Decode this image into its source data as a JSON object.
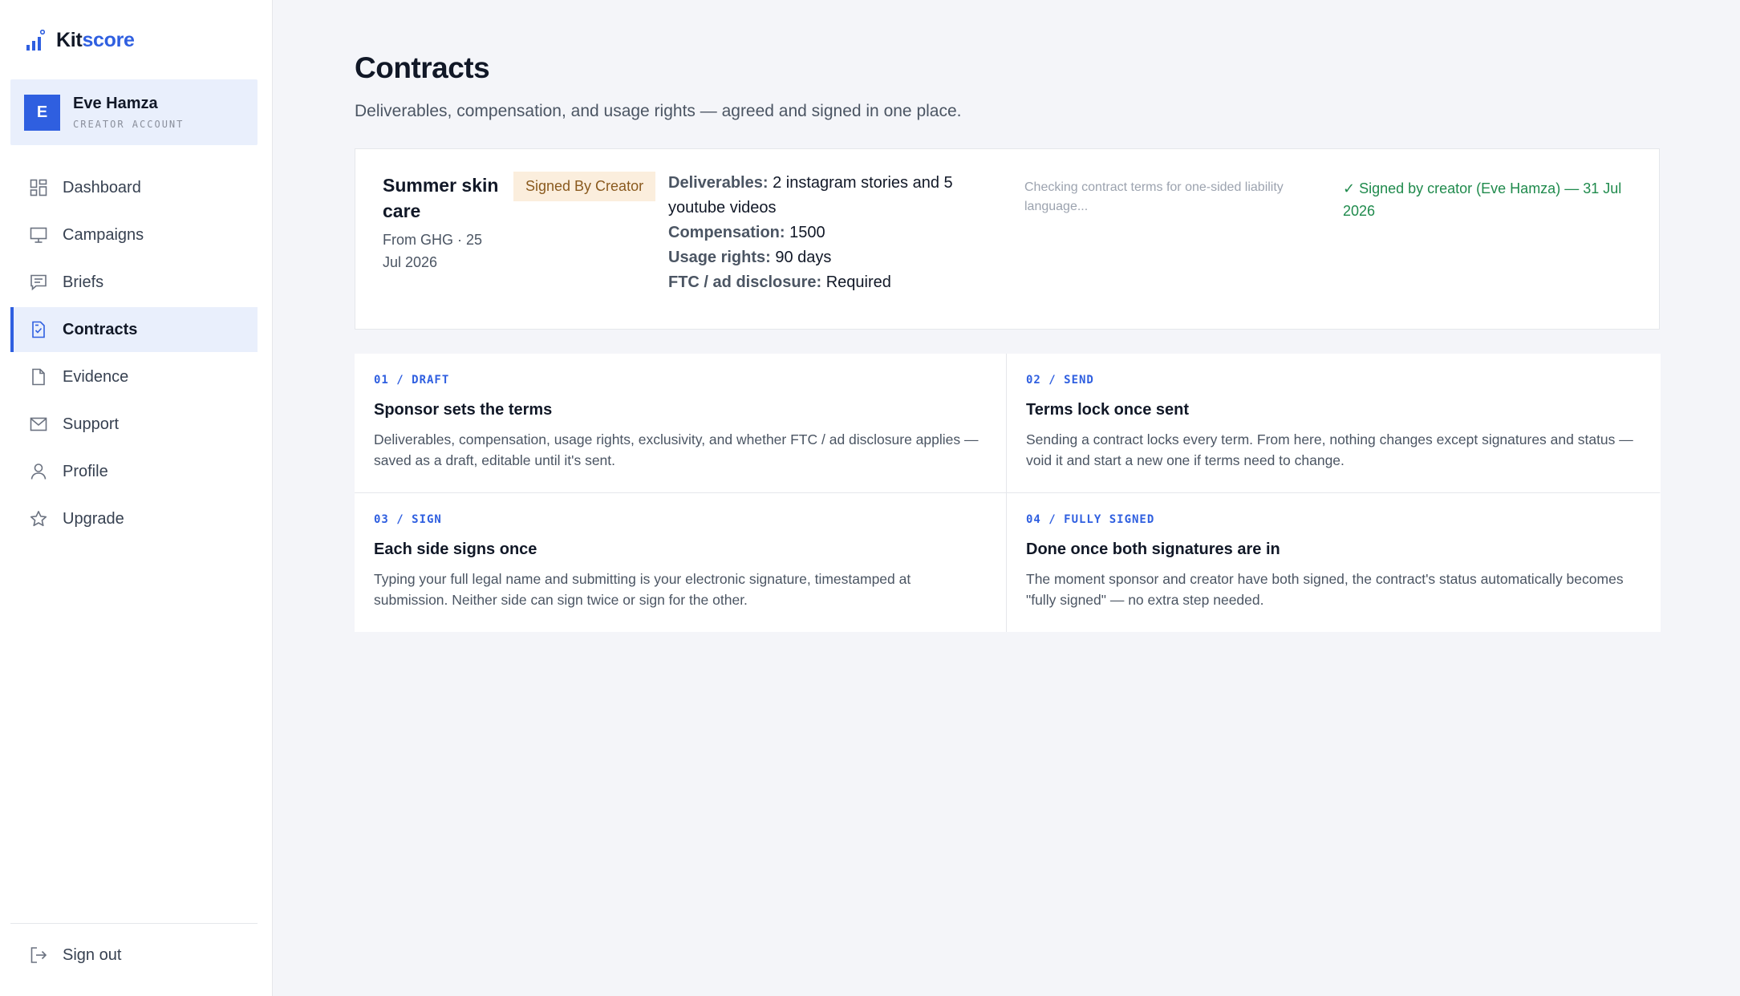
{
  "brand": {
    "name_prefix": "Kit",
    "name_accent": "score",
    "accent_color": "#2f5fe0"
  },
  "account": {
    "initial": "E",
    "name": "Eve Hamza",
    "role": "CREATOR ACCOUNT"
  },
  "nav": {
    "items": [
      {
        "label": "Dashboard",
        "icon": "dashboard-grid-icon",
        "active": false
      },
      {
        "label": "Campaigns",
        "icon": "monitor-icon",
        "active": false
      },
      {
        "label": "Briefs",
        "icon": "chat-bubble-icon",
        "active": false
      },
      {
        "label": "Contracts",
        "icon": "contract-document-icon",
        "active": true
      },
      {
        "label": "Evidence",
        "icon": "file-icon",
        "active": false
      },
      {
        "label": "Support",
        "icon": "mail-icon",
        "active": false
      },
      {
        "label": "Profile",
        "icon": "user-icon",
        "active": false
      },
      {
        "label": "Upgrade",
        "icon": "star-icon",
        "active": false
      }
    ],
    "signout": {
      "label": "Sign out",
      "icon": "sign-out-icon"
    }
  },
  "page": {
    "title": "Contracts",
    "subtitle": "Deliverables, compensation, and usage rights — agreed and signed in one place."
  },
  "contract": {
    "title": "Summer skin care",
    "from": "From GHG · 25 Jul 2026",
    "status": "Signed By Creator",
    "status_color": "#8a5a1e",
    "terms": [
      {
        "label": "Deliverables:",
        "value": "2 instagram stories and 5 youtube videos"
      },
      {
        "label": "Compensation:",
        "value": "1500"
      },
      {
        "label": "Usage rights:",
        "value": "90 days"
      },
      {
        "label": "FTC / ad disclosure:",
        "value": "Required"
      }
    ],
    "check_note": "Checking contract terms for one-sided liability language...",
    "signed_note": "✓ Signed by creator (Eve Hamza) — 31 Jul 2026",
    "signed_color": "#1f8a4c"
  },
  "steps": [
    {
      "tag": "01 / DRAFT",
      "title": "Sponsor sets the terms",
      "text": "Deliverables, compensation, usage rights, exclusivity, and whether FTC / ad disclosure applies — saved as a draft, editable until it's sent."
    },
    {
      "tag": "02 / SEND",
      "title": "Terms lock once sent",
      "text": "Sending a contract locks every term. From here, nothing changes except signatures and status — void it and start a new one if terms need to change."
    },
    {
      "tag": "03 / SIGN",
      "title": "Each side signs once",
      "text": "Typing your full legal name and submitting is your electronic signature, timestamped at submission. Neither side can sign twice or sign for the other."
    },
    {
      "tag": "04 / FULLY SIGNED",
      "title": "Done once both signatures are in",
      "text": "The moment sponsor and creator have both signed, the contract's status automatically becomes \"fully signed\" — no extra step needed."
    }
  ]
}
